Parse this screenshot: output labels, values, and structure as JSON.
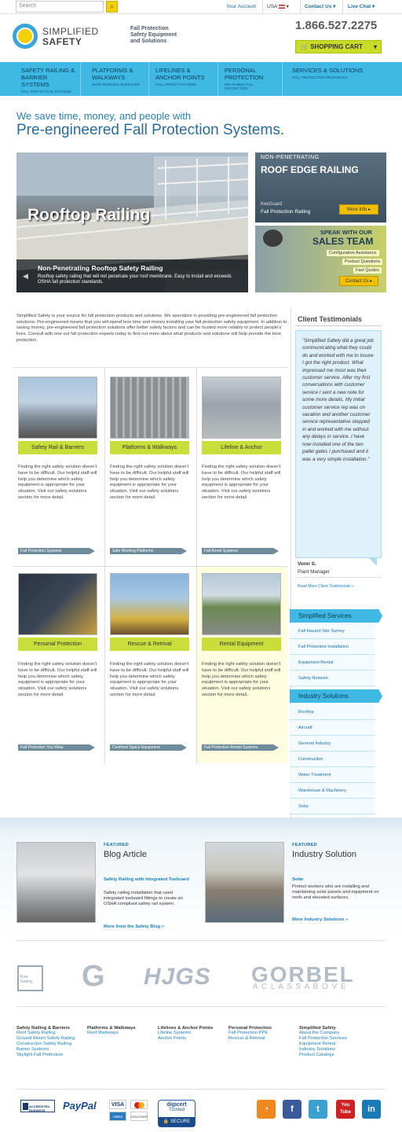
{
  "topbar": {
    "search_placeholder": "Search",
    "search_btn": "🔍",
    "your_account": "Your Account",
    "country": "USA",
    "contact": "Contact Us ▾",
    "live_chat": "Live Chat ▾"
  },
  "header": {
    "logo_line1": "SIMPLIFIED",
    "logo_line2": "SAFETY",
    "tagline": [
      "Fall Protection",
      "Safety Equipment",
      "and Solutions"
    ],
    "phone": "1.866.527.2275",
    "cart": "SHOPPING CART"
  },
  "nav": [
    {
      "label": "SAFETY RAILING & BARRIER SYSTEMS",
      "sub": "FALL PROTECTION SYSTEMS"
    },
    {
      "label": "PLATFORMS & WALKWAYS",
      "sub": "SAFE WORKING SURFACES"
    },
    {
      "label": "LIFELINES & ANCHOR POINTS",
      "sub": "FALL ARREST SYSTEMS"
    },
    {
      "label": "PERSONAL PROTECTION",
      "sub": "WEARABLE FALL PROTECTION"
    },
    {
      "label": "SERVICES & SOLUTIONS",
      "sub": "FALL PROTECTION RESOURCES"
    }
  ],
  "hero": {
    "line1": "We save time, money, and people with",
    "line2": "Pre-engineered Fall Protection Systems.",
    "banner_word": "Rooftop Railing",
    "caption_title": "Non-Penetrating Rooftop Safety Railing",
    "caption_text": "Rooftop safety railing that will not penetrate your roof membrane. Easy to install and exceeds OSHA fall protection standards.",
    "side1_small": "NON-PENETRATING",
    "side1_big": "ROOF EDGE RAILING",
    "side1_sub1": "KeeGuard",
    "side1_sub2": "Fall Protection Railing",
    "side1_btn": "More Info ▸",
    "side2_small": "SPEAK WITH OUR",
    "side2_big": "SALES TEAM",
    "side2_l1": "Configuration Assistance",
    "side2_l2": "Product Questions",
    "side2_l3": "Fast Quotes",
    "side2_btn": "Contact Us ▸"
  },
  "intro": "Simplified Safety is your source for fall protection products and solutions. We specialize in providing pre-engineered fall protection solutions. Pre-engineered means that you will spend less time and money installing your fall protection safety equipment. In addition to saving money, pre-engineered fall protection solutions offer better safety factors and can be trusted more reliably to protect people's lives. Consult with one our fall protection experts today to find out more about what products and solutions will help provide the best protection.",
  "card_text": "Finding the right safety solution doesn't have to be difficult. Our helpful staff will help you determine which safety equipment is appropriate for your situation. Visit our safety solutions section for more detail.",
  "cards": [
    {
      "label": "Safety Rail & Barriers",
      "link": "Fall Protection Systems"
    },
    {
      "label": "Platforms & Walkways",
      "link": "Safe Working Platforms"
    },
    {
      "label": "Lifeline & Anchor",
      "link": "Fall Arrest Systems"
    },
    {
      "label": "Personal Protection",
      "link": "Fall Protection You Wear"
    },
    {
      "label": "Rescue & Retrival",
      "link": "Confined Space Equipment"
    },
    {
      "label": "Rental Equipment",
      "link": "Fall Protection Rental Systems"
    }
  ],
  "testimonial": {
    "title": "Client Testimonials",
    "quote": "\"Simplified Safety did a great job communicating what they could do and worked with me to insure I got the right product. What impressed me most was their customer service. After my first conversations with customer service I sent a new note for some more details. My initial customer service rep was on vacation and another customer service representative stepped in and worked with me without any delays in service. I have now installed one of the two pallet gates I purchased and it was a very simple installation.\"",
    "name": "Vonn S.",
    "role": "Plant Manager",
    "more": "Read More Client Testimonials »"
  },
  "services": {
    "header": "Simplified Services",
    "items": [
      "Fall Hazard Site Survey",
      "Fall Protection Installation",
      "Equipment Rental",
      "Safety Network"
    ]
  },
  "industry": {
    "header": "Industry Solutions",
    "items": [
      "Rooftop",
      "Aircraft",
      "General Industry",
      "Construction",
      "Water Treatment",
      "Warehouse & Machinery",
      "Solar"
    ]
  },
  "featured": [
    {
      "small": "FEATURED",
      "title": "Blog Article",
      "link": "Safety Railing with Integrated Toeboard",
      "text": "Safety railing installation that used integrated toeboard fittings to create an OSHA compliant safety rail system.",
      "more": "More from the Safety Blog »"
    },
    {
      "small": "FEATURED",
      "title": "Industry Solution",
      "link": "Solar",
      "text": "Protect workers who are installing and maintaining solar panels and equipment on roofs and elevated surfaces.",
      "more": "More Industry Solutions »"
    }
  ],
  "brands": {
    "kee": "Kee Safety",
    "g": "G",
    "hjgs": "HJGS",
    "gorbel": "GORBEL",
    "gorbel_sub": "A  C L A S S  A B O V E"
  },
  "footer": [
    {
      "head": "Safety Railing & Barriers",
      "items": [
        "Roof Safety Railing",
        "Ground Mount Safety Railing",
        "Construction Safety Railing",
        "Barrier Systems",
        "Skylight Fall Protection"
      ]
    },
    {
      "head": "Platforms & Walkways",
      "items": [
        "Roof Walkways"
      ]
    },
    {
      "head": "Lifelines & Anchor Points",
      "items": [
        "Lifeline Systems",
        "Anchor Points"
      ]
    },
    {
      "head": "Personal Protection",
      "items": [
        "Fall Protection PPE",
        "Rescue & Retrival"
      ]
    },
    {
      "head": "Simplified Safety",
      "items": [
        "About the Company",
        "Fall Protection Services",
        "Equipment Rental",
        "Industry Solutions",
        "Product Catalogs"
      ]
    }
  ],
  "badges": {
    "bbb": "ACCREDITED BUSINESS",
    "paypal": "PayPal",
    "visa": "VISA",
    "discover": "DISCOVER",
    "amex": "AMEX",
    "digicert": "digicert",
    "trusted": "Trusted",
    "secure": "🔒 SECURE"
  },
  "social": {
    "rss": "◔",
    "fb": "f",
    "tw": "t",
    "yt": "You Tube",
    "in": "in"
  },
  "colors": {
    "accent": "#3fb8e3",
    "lime": "#c9de3a",
    "yellow": "#f5d000",
    "link": "#1a7fc0"
  }
}
